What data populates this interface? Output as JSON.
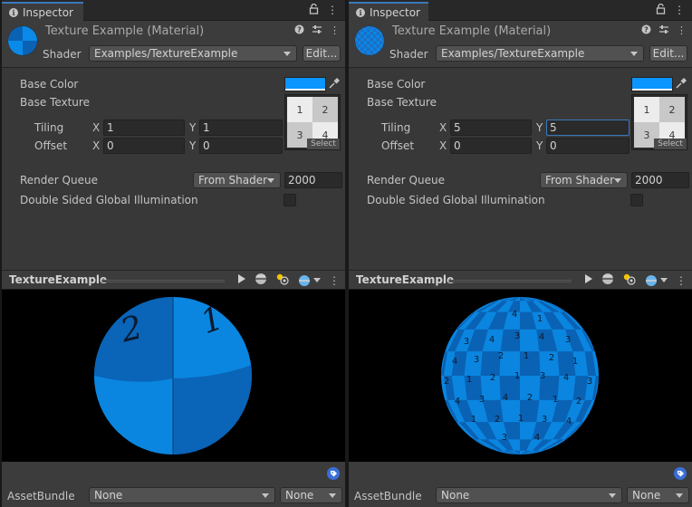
{
  "panels": [
    {
      "tab_label": "Inspector",
      "material_title": "Texture Example (Material)",
      "shader_label": "Shader",
      "shader_value": "Examples/TextureExample",
      "edit_label": "Edit...",
      "base_color_label": "Base Color",
      "base_color": "#0a95ff",
      "base_texture_label": "Base Texture",
      "tiling_label": "Tiling",
      "offset_label": "Offset",
      "x_label": "X",
      "y_label": "Y",
      "tiling_x": "1",
      "tiling_y": "1",
      "offset_x": "0",
      "offset_y": "0",
      "texture_cells": [
        "1",
        "2",
        "3",
        "4"
      ],
      "select_label": "Select",
      "render_queue_label": "Render Queue",
      "render_queue_mode": "From Shader",
      "render_queue_value": "2000",
      "dsgi_label": "Double Sided Global Illumination",
      "preview_title": "TextureExample",
      "sphere_labels": [
        "2",
        "1"
      ],
      "assetbundle_label": "AssetBundle",
      "assetbundle_value": "None",
      "variant_value": "None"
    },
    {
      "tab_label": "Inspector",
      "material_title": "Texture Example (Material)",
      "shader_label": "Shader",
      "shader_value": "Examples/TextureExample",
      "edit_label": "Edit...",
      "base_color_label": "Base Color",
      "base_color": "#0a95ff",
      "base_texture_label": "Base Texture",
      "tiling_label": "Tiling",
      "offset_label": "Offset",
      "x_label": "X",
      "y_label": "Y",
      "tiling_x": "5",
      "tiling_y": "5",
      "offset_x": "0",
      "offset_y": "0",
      "texture_cells": [
        "1",
        "2",
        "3",
        "4"
      ],
      "select_label": "Select",
      "render_queue_label": "Render Queue",
      "render_queue_mode": "From Shader",
      "render_queue_value": "2000",
      "dsgi_label": "Double Sided Global Illumination",
      "preview_title": "TextureExample",
      "sphere_labels": [
        "4",
        "1",
        "3",
        "4",
        "3",
        "4",
        "3",
        "4",
        "3",
        "2",
        "1",
        "2",
        "1",
        "2",
        "1",
        "2",
        "1",
        "3",
        "4",
        "3",
        "4",
        "3",
        "4",
        "2",
        "1",
        "2",
        "1",
        "2",
        "1",
        "3",
        "4",
        "3",
        "4"
      ],
      "assetbundle_label": "AssetBundle",
      "assetbundle_value": "None",
      "variant_value": "None"
    }
  ],
  "icons": {
    "info": "info-icon",
    "lock": "lock-icon",
    "menu": "kebab-menu-icon",
    "help": "help-icon",
    "settings": "preset-settings-icon",
    "eyedropper": "eyedropper-icon",
    "play": "play-icon",
    "sphere": "sphere-icon",
    "lights": "lights-icon",
    "tag": "tag-icon"
  }
}
